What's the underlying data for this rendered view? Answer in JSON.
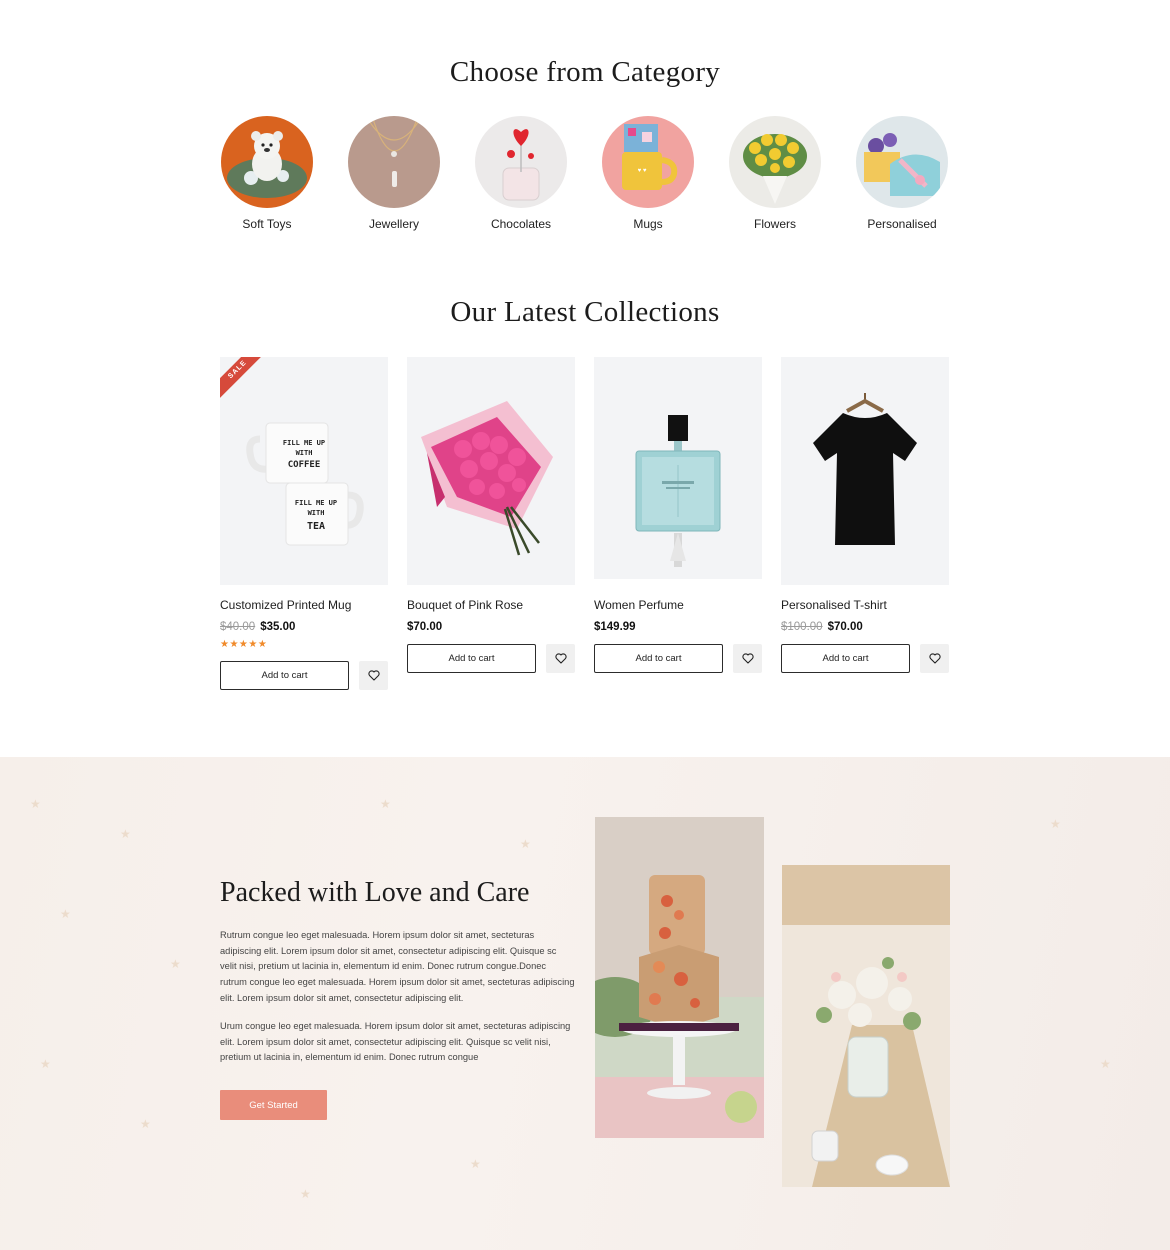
{
  "categories_section": {
    "title": "Choose from Category",
    "items": [
      {
        "label": "Soft Toys",
        "icon": "teddy-bear-image"
      },
      {
        "label": "Jewellery",
        "icon": "necklace-image"
      },
      {
        "label": "Chocolates",
        "icon": "lollipop-jar-image"
      },
      {
        "label": "Mugs",
        "icon": "yellow-mug-image"
      },
      {
        "label": "Flowers",
        "icon": "yellow-bouquet-image"
      },
      {
        "label": "Personalised",
        "icon": "gift-box-image"
      }
    ]
  },
  "collections_section": {
    "title": "Our Latest Collections",
    "products": [
      {
        "name": "Customized Printed Mug",
        "old_price": "$40.00",
        "price": "$35.00",
        "badge": "SALE",
        "rating": 5,
        "stars": "★★★★★",
        "cart_label": "Add to cart"
      },
      {
        "name": "Bouquet of Pink Rose",
        "old_price": "",
        "price": "$70.00",
        "cart_label": "Add to cart"
      },
      {
        "name": "Women Perfume",
        "old_price": "",
        "price": "$149.99",
        "cart_label": "Add to cart"
      },
      {
        "name": "Personalised T-shirt",
        "old_price": "$100.00",
        "price": "$70.00",
        "cart_label": "Add to cart"
      }
    ],
    "mug_text_top": [
      "FILL ME UP",
      "WITH",
      "COFFEE"
    ],
    "mug_text_bottom": [
      "FILL ME UP",
      "WITH",
      "TEA"
    ]
  },
  "love_section": {
    "title": "Packed with Love and Care",
    "paragraph_1": "Rutrum congue leo eget malesuada. Horem ipsum dolor sit amet, secteturas adipiscing elit. Lorem ipsum dolor sit amet, consectetur adipiscing elit. Quisque  sc velit nisi, pretium ut lacinia in, elementum id enim. Donec rutrum congue.Donec rutrum congue leo eget malesuada. Horem ipsum dolor sit amet, secteturas adipiscing elit. Lorem ipsum dolor sit amet, consectetur adipiscing elit.",
    "paragraph_2": "Urum congue leo eget malesuada. Horem ipsum dolor sit amet, secteturas adipiscing elit. Lorem ipsum dolor sit amet, consectetur adipiscing elit. Quisque  sc velit nisi, pretium ut lacinia in, elementum id enim. Donec rutrum congue",
    "cta_label": "Get Started"
  },
  "colors": {
    "accent": "#e98d7b",
    "sale_badge": "#d64a3b",
    "star": "#f08a2a",
    "card_bg": "#f3f4f6"
  }
}
